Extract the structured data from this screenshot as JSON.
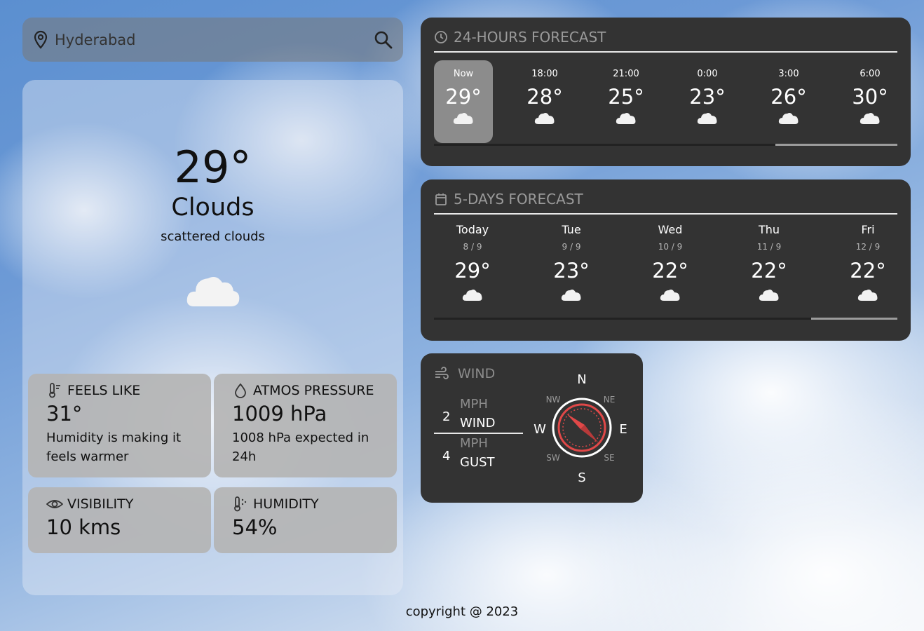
{
  "search": {
    "placeholder": "Hyderabad",
    "value": ""
  },
  "current": {
    "temp": "29°",
    "main": "Clouds",
    "description": "scattered clouds",
    "icon": "cloud-icon"
  },
  "highlights": {
    "feels_like": {
      "title": "FEELS LIKE",
      "value": "31°",
      "desc": "Humidity is making it feels warmer",
      "icon": "thermometer-icon"
    },
    "pressure": {
      "title": "ATMOS PRESSURE",
      "value": "1009 hPa",
      "desc": "1008 hPa expected in 24h",
      "icon": "droplet-icon"
    },
    "visibility": {
      "title": "VISIBILITY",
      "value": "10 kms",
      "icon": "eye-icon"
    },
    "humidity": {
      "title": "HUMIDITY",
      "value": "54%",
      "icon": "humidity-icon"
    }
  },
  "hourly": {
    "title": "24-HOURS FORECAST",
    "items": [
      {
        "time": "Now",
        "temp": "29°",
        "icon": "cloud-icon"
      },
      {
        "time": "18:00",
        "temp": "28°",
        "icon": "cloud-icon"
      },
      {
        "time": "21:00",
        "temp": "25°",
        "icon": "cloud-icon"
      },
      {
        "time": "0:00",
        "temp": "23°",
        "icon": "cloud-icon"
      },
      {
        "time": "3:00",
        "temp": "26°",
        "icon": "cloud-icon"
      },
      {
        "time": "6:00",
        "temp": "30°",
        "icon": "cloud-icon"
      }
    ]
  },
  "daily": {
    "title": "5-DAYS FORECAST",
    "items": [
      {
        "day": "Today",
        "date": "8 / 9",
        "temp": "29°",
        "icon": "cloud-icon"
      },
      {
        "day": "Tue",
        "date": "9 / 9",
        "temp": "23°",
        "icon": "cloud-icon"
      },
      {
        "day": "Wed",
        "date": "10 / 9",
        "temp": "22°",
        "icon": "cloud-icon"
      },
      {
        "day": "Thu",
        "date": "11 / 9",
        "temp": "22°",
        "icon": "cloud-icon"
      },
      {
        "day": "Fri",
        "date": "12 / 9",
        "temp": "22°",
        "icon": "cloud-icon"
      }
    ]
  },
  "wind": {
    "title": "WIND",
    "speed": {
      "value": "2",
      "unit": "MPH",
      "label": "WIND"
    },
    "gust": {
      "value": "4",
      "unit": "MPH",
      "label": "GUST"
    },
    "compass": {
      "n": "N",
      "s": "S",
      "e": "E",
      "w": "W",
      "ne": "NE",
      "nw": "NW",
      "se": "SE",
      "sw": "SW"
    },
    "accent_color": "#e04848"
  },
  "footer": "copyright @ 2023"
}
